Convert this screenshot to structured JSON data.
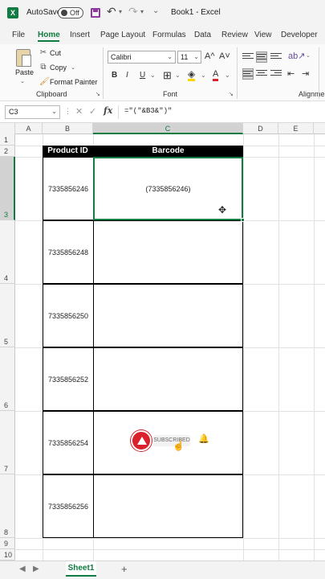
{
  "titlebar": {
    "logo_letter": "X",
    "autosave_label": "AutoSave",
    "autosave_state": "Off",
    "document_title": "Book1 - Excel",
    "icons": [
      "excel-logo-icon",
      "save-icon",
      "undo-icon",
      "redo-icon",
      "customize-icon"
    ]
  },
  "menu": {
    "tabs": [
      "File",
      "Home",
      "Insert",
      "Page Layout",
      "Formulas",
      "Data",
      "Review",
      "View",
      "Developer"
    ],
    "active": "Home"
  },
  "ribbon": {
    "clipboard": {
      "paste": "Paste",
      "cut": "Cut",
      "copy": "Copy",
      "format_painter": "Format Painter",
      "group_label": "Clipboard"
    },
    "font": {
      "font_name": "Calibri",
      "font_size": "11",
      "bold": "B",
      "italic": "I",
      "underline": "U",
      "grow": "A^",
      "shrink": "A˅",
      "font_color": "A",
      "group_label": "Font"
    },
    "alignment": {
      "group_label": "Alignmen"
    }
  },
  "formula_bar": {
    "name_box": "C3",
    "fx": "fx",
    "formula": "=\"(\"&B3&\")\""
  },
  "columns": [
    "A",
    "B",
    "C",
    "D",
    "E"
  ],
  "rows": [
    "1",
    "2",
    "3",
    "4",
    "5",
    "6",
    "7",
    "8",
    "9",
    "10"
  ],
  "table": {
    "headers": [
      "Product ID",
      "Barcode"
    ],
    "rows": [
      {
        "product_id": "7335856246",
        "barcode": "(7335856246)"
      },
      {
        "product_id": "7335856248",
        "barcode": ""
      },
      {
        "product_id": "7335856250",
        "barcode": ""
      },
      {
        "product_id": "7335856252",
        "barcode": ""
      },
      {
        "product_id": "7335856254",
        "barcode": ""
      },
      {
        "product_id": "7335856256",
        "barcode": ""
      }
    ]
  },
  "overlay": {
    "subscribe_text": "SUBSCRIBED"
  },
  "sheets": {
    "tabs": [
      "Sheet1"
    ],
    "add": "+"
  },
  "colors": {
    "accent": "#107c41",
    "subscribe_red": "#d9202b"
  }
}
